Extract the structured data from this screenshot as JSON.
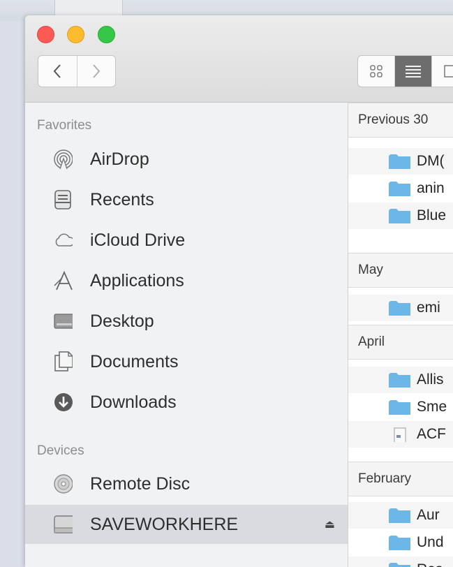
{
  "sidebar": {
    "favorites_header": "Favorites",
    "favorites": [
      {
        "label": "AirDrop",
        "icon": "airdrop-icon"
      },
      {
        "label": "Recents",
        "icon": "recents-icon"
      },
      {
        "label": "iCloud Drive",
        "icon": "icloud-icon"
      },
      {
        "label": "Applications",
        "icon": "applications-icon"
      },
      {
        "label": "Desktop",
        "icon": "desktop-icon"
      },
      {
        "label": "Documents",
        "icon": "documents-icon"
      },
      {
        "label": "Downloads",
        "icon": "downloads-icon"
      }
    ],
    "devices_header": "Devices",
    "devices": [
      {
        "label": "Remote Disc",
        "icon": "disc-icon"
      },
      {
        "label": "SAVEWORKHERE",
        "icon": "drive-icon",
        "selected": true,
        "eject": "⏏"
      }
    ]
  },
  "content": {
    "groups": [
      {
        "header": "Previous 30",
        "rows": [
          "DM(",
          "anin",
          "Blue"
        ]
      },
      {
        "header": "May",
        "rows": [
          "emi"
        ]
      },
      {
        "header": "April",
        "rows": [
          "Allis",
          "Sme",
          "ACF"
        ]
      },
      {
        "header": "February",
        "rows": [
          "Aur",
          "Und",
          "Res"
        ]
      }
    ]
  },
  "colors": {
    "folder": "#6cb6e8",
    "selection": "#d9dbe0",
    "close": "#fc5a55",
    "minimize": "#fdbb2e",
    "zoom": "#34c748"
  }
}
